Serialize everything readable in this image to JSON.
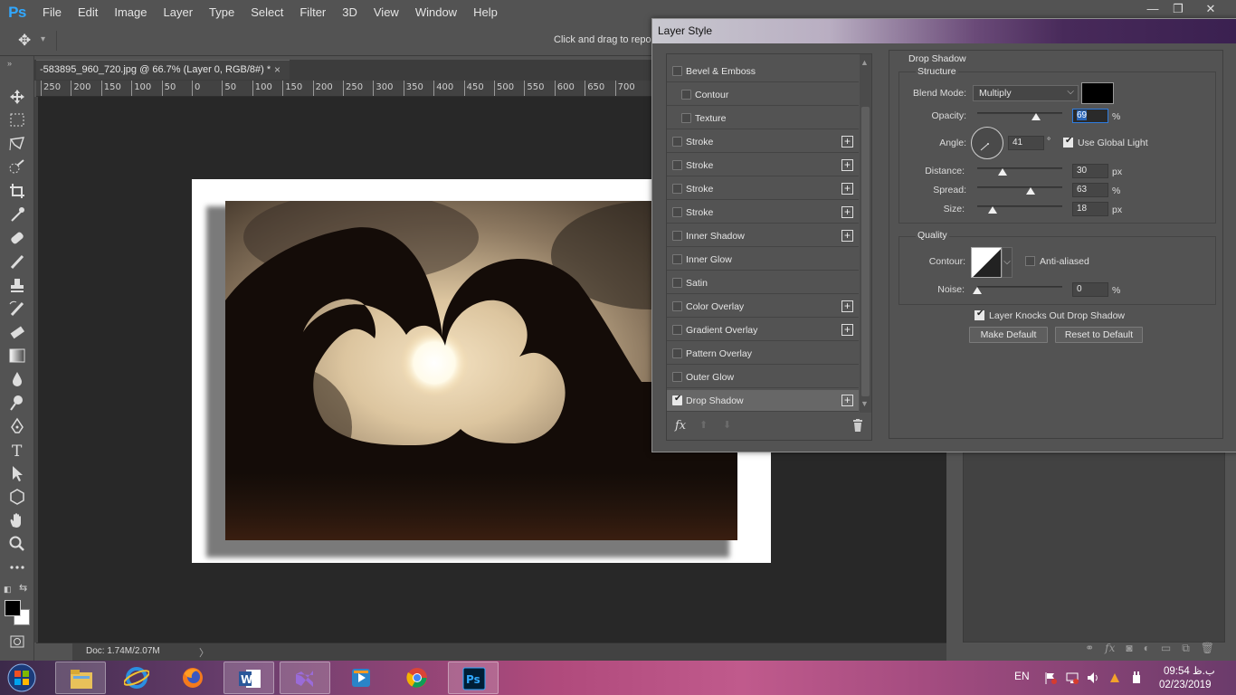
{
  "app": {
    "logo": "Ps",
    "menu": [
      "File",
      "Edit",
      "Image",
      "Layer",
      "Type",
      "Select",
      "Filter",
      "3D",
      "View",
      "Window",
      "Help"
    ],
    "window_controls": [
      "—",
      "❐",
      "✕"
    ]
  },
  "options_bar": {
    "hint": "Click and drag to reposi"
  },
  "document": {
    "tab_title": "-583895_960_720.jpg @ 66.7% (Layer 0, RGB/8#) *",
    "tab_close": "×",
    "ruler_labels": [
      "250",
      "200",
      "150",
      "100",
      "50",
      "0",
      "50",
      "100",
      "150",
      "200",
      "250",
      "300",
      "350",
      "400",
      "450",
      "500",
      "550",
      "600",
      "650",
      "700"
    ],
    "status": "Doc: 1.74M/2.07M",
    "status_arrow": "〉"
  },
  "dialog": {
    "title": "Layer Style",
    "styles": [
      {
        "label": "Bevel & Emboss",
        "checked": false,
        "plus": false,
        "indent": false
      },
      {
        "label": "Contour",
        "checked": false,
        "plus": false,
        "indent": true
      },
      {
        "label": "Texture",
        "checked": false,
        "plus": false,
        "indent": true
      },
      {
        "label": "Stroke",
        "checked": false,
        "plus": true,
        "indent": false
      },
      {
        "label": "Stroke",
        "checked": false,
        "plus": true,
        "indent": false
      },
      {
        "label": "Stroke",
        "checked": false,
        "plus": true,
        "indent": false
      },
      {
        "label": "Stroke",
        "checked": false,
        "plus": true,
        "indent": false
      },
      {
        "label": "Inner Shadow",
        "checked": false,
        "plus": true,
        "indent": false
      },
      {
        "label": "Inner Glow",
        "checked": false,
        "plus": false,
        "indent": false
      },
      {
        "label": "Satin",
        "checked": false,
        "plus": false,
        "indent": false
      },
      {
        "label": "Color Overlay",
        "checked": false,
        "plus": true,
        "indent": false
      },
      {
        "label": "Gradient Overlay",
        "checked": false,
        "plus": true,
        "indent": false
      },
      {
        "label": "Pattern Overlay",
        "checked": false,
        "plus": false,
        "indent": false
      },
      {
        "label": "Outer Glow",
        "checked": false,
        "plus": false,
        "indent": false
      },
      {
        "label": "Drop Shadow",
        "checked": true,
        "plus": true,
        "indent": false,
        "selected": true
      }
    ],
    "footer": {
      "fx": "fx",
      "up": "⬆",
      "down": "⬇"
    },
    "drop_shadow": {
      "title": "Drop Shadow",
      "structure": "Structure",
      "blend_mode_label": "Blend Mode:",
      "blend_mode": "Multiply",
      "shadow_color": "#000000",
      "opacity_label": "Opacity:",
      "opacity": "69",
      "opacity_value": 69,
      "percent": "%",
      "angle_label": "Angle:",
      "angle": "41",
      "degree": "°",
      "use_global_light": "Use Global Light",
      "use_global_light_checked": true,
      "distance_label": "Distance:",
      "distance": "30",
      "distance_value": 30,
      "spread_label": "Spread:",
      "spread": "63",
      "spread_value": 63,
      "size_label": "Size:",
      "size": "18",
      "size_value": 18,
      "px": "px",
      "quality": "Quality",
      "contour_label": "Contour:",
      "anti_aliased": "Anti-aliased",
      "anti_aliased_checked": false,
      "noise_label": "Noise:",
      "noise": "0",
      "noise_value": 0,
      "knocks_out": "Layer Knocks Out Drop Shadow",
      "knocks_out_checked": true,
      "make_default": "Make Default",
      "reset_default": "Reset to Default"
    }
  },
  "taskbar": {
    "lang": "EN",
    "time": "09:54 ب.ظ",
    "date": "02/23/2019"
  },
  "colors": {
    "ui_bg": "#535353",
    "canvas_bg": "#282828",
    "accent_blue": "#31a8ff",
    "selection": "#2c67b8"
  }
}
